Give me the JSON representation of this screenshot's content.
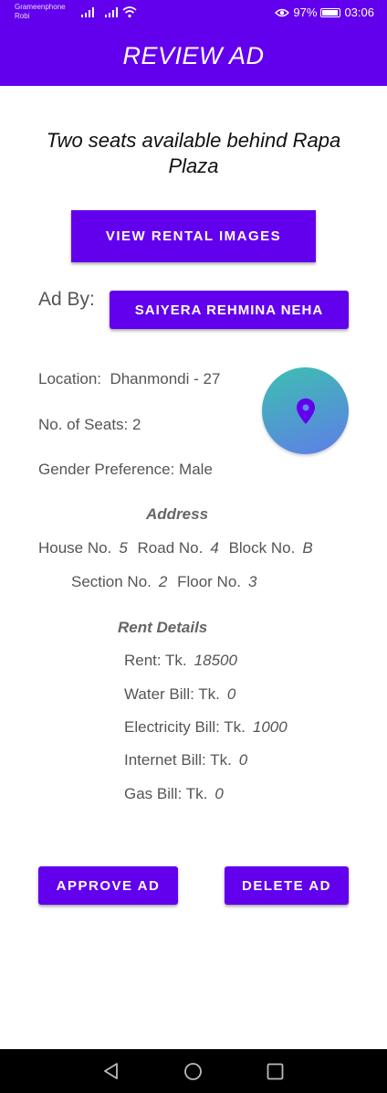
{
  "status_bar": {
    "carrier_1": "Grameenphone",
    "carrier_2": "Robi",
    "battery": "97%",
    "time": "03:06"
  },
  "app_bar": {
    "title": "REVIEW AD"
  },
  "ad": {
    "title": "Two seats available behind Rapa Plaza",
    "view_images_label": "VIEW RENTAL IMAGES",
    "ad_by_label": "Ad By:",
    "advertiser_name": "SAIYERA REHMINA NEHA",
    "location_label": "Location:",
    "location_value": "Dhanmondi - 27",
    "seats_label": "No. of Seats:",
    "seats_value": "2",
    "gender_label": "Gender Preference:",
    "gender_value": "Male"
  },
  "address": {
    "heading": "Address",
    "house_label": "House No.",
    "house_value": "5",
    "road_label": "Road No.",
    "road_value": "4",
    "block_label": "Block No.",
    "block_value": "B",
    "section_label": "Section No.",
    "section_value": "2",
    "floor_label": "Floor No.",
    "floor_value": "3"
  },
  "rent": {
    "heading": "Rent Details",
    "rent_label": "Rent: Tk.",
    "rent_value": "18500",
    "water_label": "Water Bill: Tk.",
    "water_value": "0",
    "electricity_label": "Electricity Bill: Tk.",
    "electricity_value": "1000",
    "internet_label": "Internet Bill: Tk.",
    "internet_value": "0",
    "gas_label": "Gas Bill: Tk.",
    "gas_value": "0"
  },
  "actions": {
    "approve_label": "APPROVE AD",
    "delete_label": "DELETE AD"
  },
  "icons": {
    "map": "location-pin-icon",
    "nav_back": "back-triangle-icon",
    "nav_home": "home-circle-icon",
    "nav_recents": "recents-square-icon"
  },
  "colors": {
    "primary": "#6200EE",
    "map_gradient_start": "#3cc0b0",
    "map_gradient_end": "#5f7de8"
  }
}
